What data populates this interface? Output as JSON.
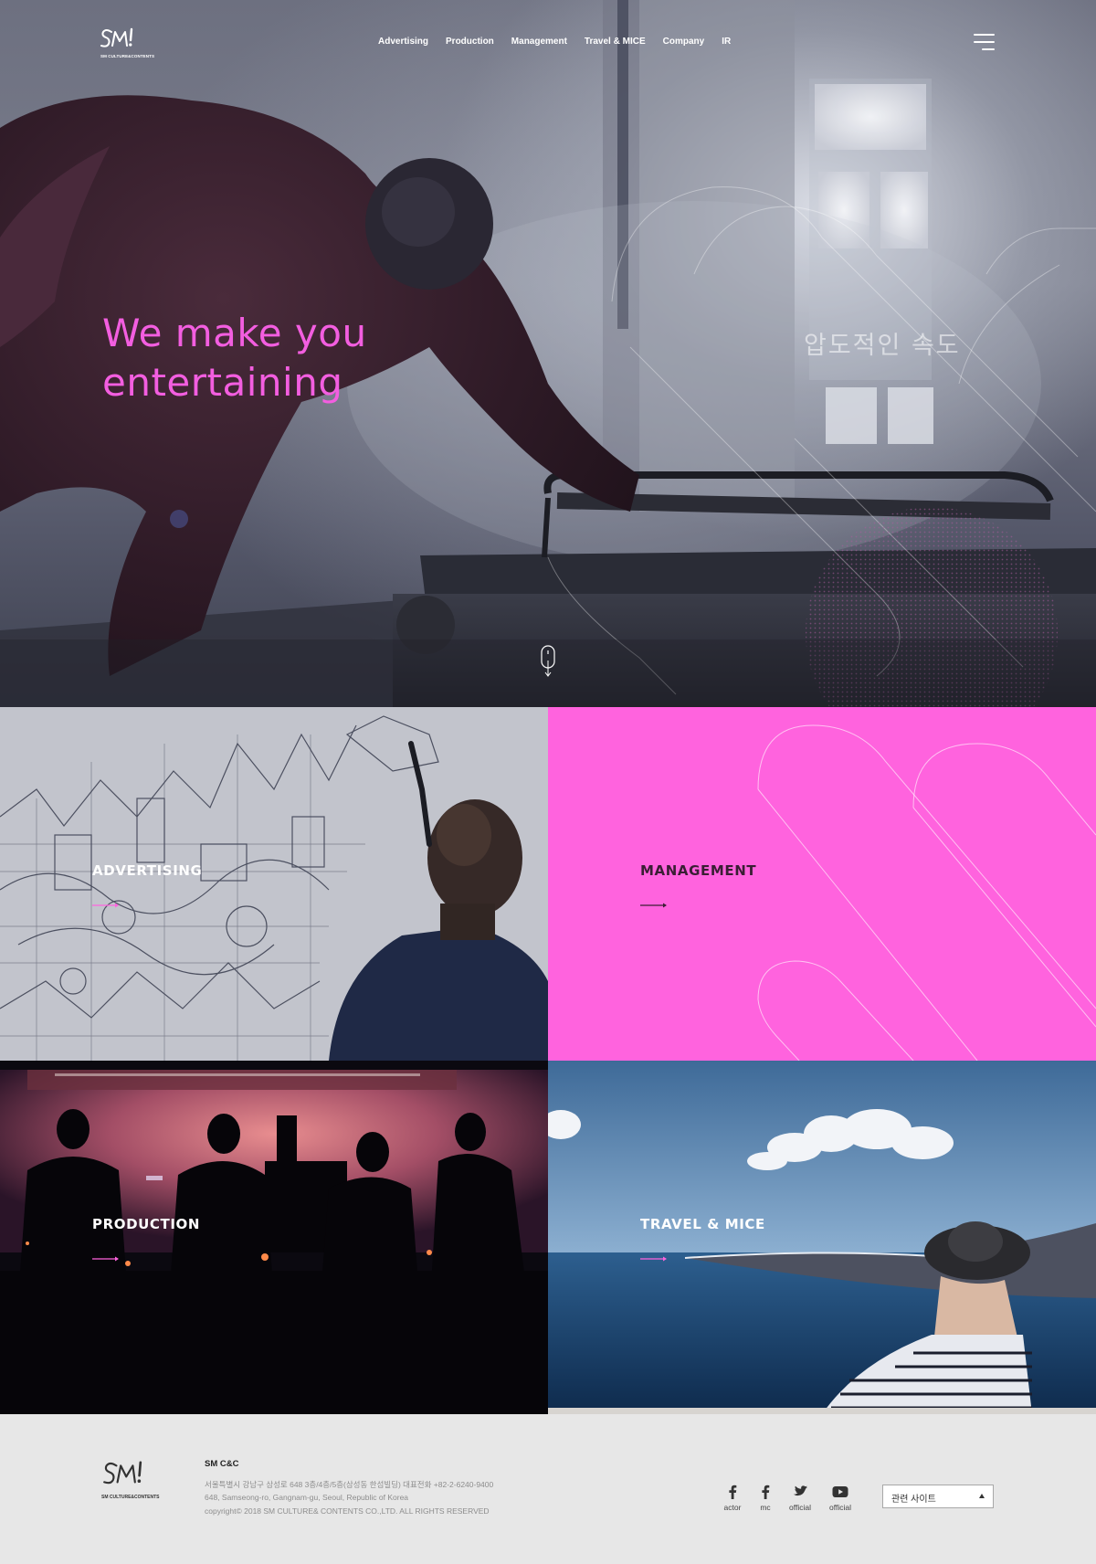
{
  "brand": {
    "logo_mark": "SM!",
    "logo_text": "SM CULTURE&CONTENTS"
  },
  "nav": {
    "items": [
      {
        "label": "Advertising"
      },
      {
        "label": "Production"
      },
      {
        "label": "Management"
      },
      {
        "label": "Travel & MICE"
      },
      {
        "label": "Company"
      },
      {
        "label": "IR"
      }
    ],
    "menu_icon": "hamburger-icon"
  },
  "hero": {
    "title_line1": "We make you",
    "title_line2": "entertaining",
    "video_caption": "압도적인 속도",
    "scroll_icon": "mouse-scroll-icon"
  },
  "tiles": [
    {
      "label": "ADVERTISING",
      "arrow_color": "#ff63de"
    },
    {
      "label": "MANAGEMENT",
      "arrow_color": "#3a1e34"
    },
    {
      "label": "PRODUCTION",
      "arrow_color": "#ff63de"
    },
    {
      "label": "TRAVEL & MICE",
      "arrow_color": "#ff63de"
    }
  ],
  "footer": {
    "logo_text": "SM CULTURE&CONTENTS",
    "company": "SM C&C",
    "address_ko": "서울특별시 강남구 삼성로 648 3층/4층/5층(삼성동 한섬빌딩) 대표전화 +82-2-6240-9400",
    "address_en": "648, Samseong-ro, Gangnam-gu, Seoul, Republic of Korea",
    "copyright": "copyright© 2018 SM CULTURE& CONTENTS CO.,LTD. ALL RIGHTS RESERVED",
    "social": [
      {
        "icon": "facebook-icon",
        "label": "actor"
      },
      {
        "icon": "facebook-icon",
        "label": "mc"
      },
      {
        "icon": "twitter-icon",
        "label": "official"
      },
      {
        "icon": "youtube-icon",
        "label": "official"
      }
    ],
    "related_sites": "관련 사이트"
  },
  "colors": {
    "accent_pink": "#ff63de",
    "hero_title": "#f35ee0",
    "footer_bg": "#e7e7e7"
  }
}
